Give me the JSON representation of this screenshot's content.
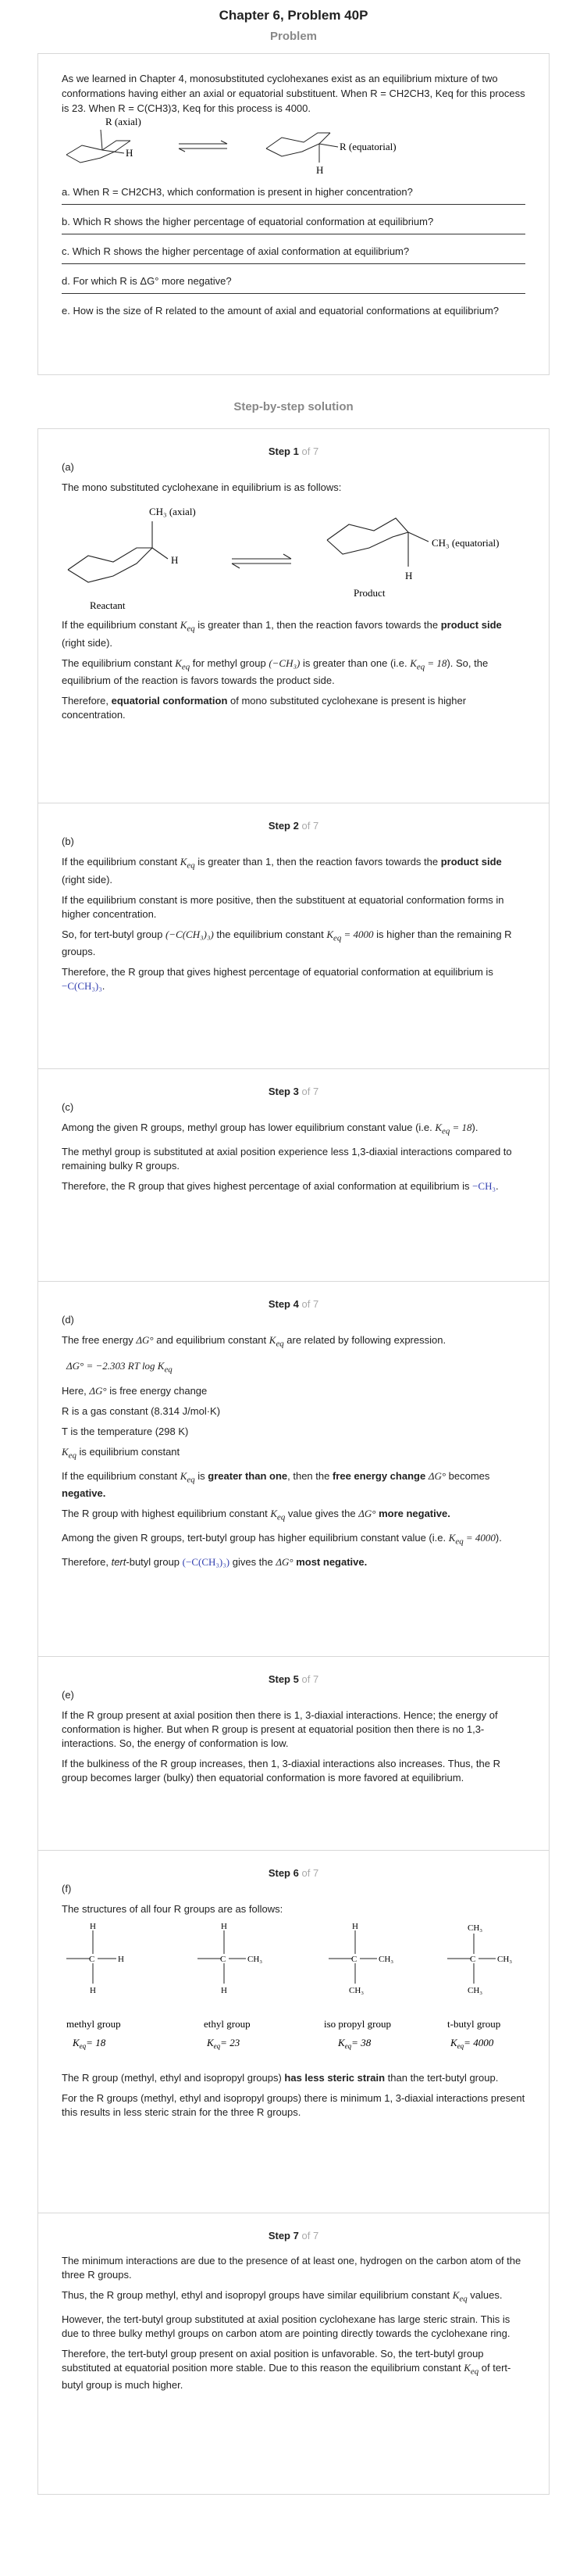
{
  "title": "Chapter 6, Problem 40P",
  "problem_heading": "Problem",
  "problem": {
    "intro": "As we learned in Chapter 4, monosubstituted cyclohexanes exist as an equilibrium mixture of two conformations having either an axial or equatorial substituent. When R = CH2CH3, Keq for this process is 23. When R = C(CH3)3, Keq for this process is 4000.",
    "fig": {
      "r_axial": "R  (axial)",
      "h": "H",
      "r_eq": "R (equatorial)"
    },
    "questions": [
      "a. When R = CH2CH3, which conformation is present in higher concentration?",
      "b. Which R shows the higher percentage of equatorial conformation at equilibrium?",
      "c. Which R shows the higher percentage of axial conformation at equilibrium?",
      "d. For which R is ΔG° more negative?",
      "e. How is the size of R related to the amount of axial and equatorial conformations at equilibrium?"
    ]
  },
  "solution_heading": "Step-by-step solution",
  "step_word": "Step",
  "step_of": "of 7",
  "steps": {
    "s1": {
      "num": "1",
      "label": "(a)",
      "p1": "The mono substituted cyclohexane in equilibrium is as follows:",
      "fig": {
        "ch3_axial": "CH₃ (axial)",
        "h1": "H",
        "reactant": "Reactant",
        "ch3_eq": "CH₃ (equatorial)",
        "h2": "H",
        "product": "Product"
      },
      "p2a": "If the equilibrium constant ",
      "p2m": "K",
      "p2sub": "eq",
      "p2b": " is greater than 1, then the reaction favors towards the ",
      "p2c": "product side",
      "p2d": " (right side).",
      "p3a": "The equilibrium constant ",
      "p3b": " for methyl group ",
      "p3c": "(−CH₃)",
      "p3d": " is greater than one (i.e. ",
      "p3e": "K",
      "p3f": "eq",
      "p3g": " = 18",
      "p3h": "). So, the equilibrium of the reaction is favors towards the product side.",
      "p4a": "Therefore, ",
      "p4b": "equatorial conformation",
      "p4c": " of mono substituted cyclohexane is present is higher concentration."
    },
    "s2": {
      "num": "2",
      "label": "(b)",
      "p1a": "If the equilibrium constant ",
      "p1b": " is greater than 1, then the reaction favors towards the ",
      "p1c": "product side",
      "p1d": " (right side).",
      "p2": "If the equilibrium constant is more positive, then the substituent at equatorial conformation forms in higher concentration.",
      "p3a": "So, for tert-butyl group ",
      "p3b": "(−C(CH₃)₃)",
      "p3c": " the equilibrium constant ",
      "p3d": " = 4000",
      "p3e": " is higher than the remaining R groups.",
      "p4a": "Therefore, the R group that gives highest percentage of equatorial conformation at equilibrium is ",
      "p4b": "−C(CH₃)₃",
      "p4c": "."
    },
    "s3": {
      "num": "3",
      "label": "(c)",
      "p1a": "Among the given R groups, methyl group has lower equilibrium constant value (i.e. ",
      "p1b": " = 18",
      "p1c": ").",
      "p2": "The methyl group is substituted at axial position experience less 1,3-diaxial interactions compared to remaining bulky R groups.",
      "p3a": "Therefore, the R group that gives highest percentage of axial conformation at equilibrium is ",
      "p3b": "−CH₃",
      "p3c": "."
    },
    "s4": {
      "num": "4",
      "label": "(d)",
      "p1a": "The free energy ",
      "p1b": "ΔG°",
      "p1c": " and equilibrium constant ",
      "p1d": " are related by following expression.",
      "eq": "ΔG° = −2.303 RT log K",
      "here": "Here,  ",
      "here2": " is free energy change",
      "r": "R is a gas constant (8.314 J/mol·K)",
      "t": "T is the temperature (298 K)",
      "k": " is equilibrium constant",
      "p2a": "If the equilibrium constant ",
      "p2b": " is ",
      "p2c": "greater than one",
      "p2d": ", then the ",
      "p2e": "free energy change",
      "p2f": " becomes ",
      "p2g": "negative.",
      "p3a": "The R group with highest equilibrium constant ",
      "p3b": " value gives the ",
      "p3c": " more negative.",
      "p4a": "Among the given R groups, tert-butyl group has higher equilibrium constant value (i.e. ",
      "p4b": " = 4000",
      "p4c": ").",
      "p5a": "Therefore, ",
      "p5b": "tert",
      "p5c": "-butyl group ",
      "p5d": "(−C(CH₃)₃)",
      "p5e": " gives the ",
      "p5f": " most negative."
    },
    "s5": {
      "num": "5",
      "label": "(e)",
      "p1": "If the R group present at axial position then there is 1, 3-diaxial interactions. Hence; the energy of conformation is higher. But when R group is present at equatorial position then there is no 1,3-interactions. So, the energy of conformation is low.",
      "p2": "If the bulkiness of the R group increases, then 1, 3-diaxial interactions also increases. Thus, the R group becomes larger (bulky) then equatorial conformation is more favored at equilibrium."
    },
    "s6": {
      "num": "6",
      "label": "(f)",
      "p1": "The structures of all four R groups are as follows:",
      "groups": [
        {
          "name": "methyl group",
          "k": "= 18"
        },
        {
          "name": "ethyl group",
          "k": "= 23"
        },
        {
          "name": "iso propyl group",
          "k": "= 38"
        },
        {
          "name": "t-butyl group",
          "k": "= 4000"
        }
      ],
      "atoms": {
        "h": "H",
        "c": "C",
        "ch3": "CH₃"
      },
      "p2a": "The R group (methyl, ethyl and isopropyl groups) ",
      "p2b": "has less steric strain",
      "p2c": " than the tert-butyl group.",
      "p3": "For the R groups (methyl, ethyl and isopropyl groups) there is minimum 1, 3-diaxial interactions present this results in less steric strain for the three R groups."
    },
    "s7": {
      "num": "7",
      "p1": "The minimum interactions are due to the presence of at least one, hydrogen on the carbon atom of the three R groups.",
      "p2a": "Thus, the R group methyl, ethyl and isopropyl groups have similar equilibrium constant ",
      "p2b": " values.",
      "p3": "However, the tert-butyl group substituted at axial position cyclohexane has large steric strain. This is due to three bulky methyl groups on carbon atom are pointing directly towards the cyclohexane ring.",
      "p4a": "Therefore, the tert-butyl group present on axial position is unfavorable. So, the tert-butyl group substituted at equatorial position more stable. Due to this reason the equilibrium constant ",
      "p4b": " of tert-butyl group is much higher."
    }
  },
  "k_symbol": "K",
  "k_sub": "eq"
}
